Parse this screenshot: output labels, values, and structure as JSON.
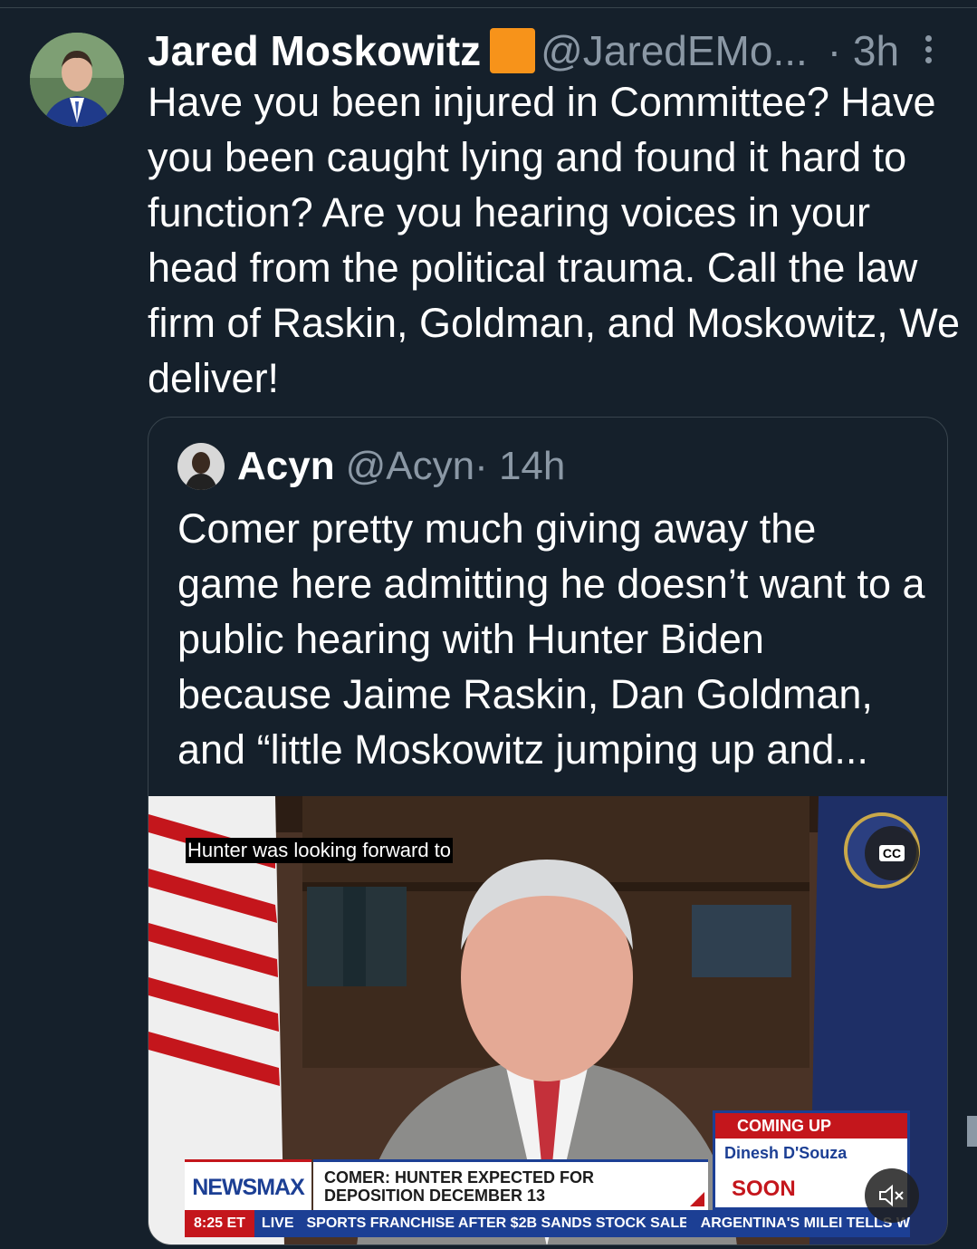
{
  "tweet": {
    "author_name": "Jared Moskowitz",
    "author_handle": "@JaredEMo...",
    "time": "· 3h",
    "text": "Have you been injured in Committee? Have you been caught lying and found it hard to function? Are you hearing voices in your head from the political trauma. Call the law firm of Raskin, Goldman, and Moskowitz, We deliver!"
  },
  "quote": {
    "author_name": "Acyn",
    "author_handle": "@Acyn",
    "time": "· 14h",
    "text": "Comer pretty much giving away the game here admitting he doesn’t want to a public hearing with Hunter Biden because Jaime Raskin, Dan Goldman, and “little Moskowitz jumping up and..."
  },
  "video": {
    "caption": "Hunter was looking forward to",
    "cc_label": "CC",
    "network": "NEWSMAX",
    "headline": "COMER: HUNTER EXPECTED FOR DEPOSITION DECEMBER 13",
    "coming_up_label": "COMING UP",
    "coming_up_name": "Dinesh D'Souza",
    "soon_label": "SOON",
    "ticker_time": "8:25 ET",
    "ticker_live": "LIVE",
    "ticker_text_1": "SPORTS FRANCHISE AFTER $2B SANDS STOCK SALE . . .",
    "ticker_text_2": "ARGENTINA'S MILEI TELLS W"
  },
  "colors": {
    "background": "#15202b",
    "secondary_text": "#8b98a5",
    "newsmax_blue": "#1c3f94",
    "newsmax_red": "#c4161c"
  },
  "icons": [
    "verified-square-icon",
    "more-options-icon",
    "closed-captions-icon",
    "muted-speaker-icon"
  ]
}
